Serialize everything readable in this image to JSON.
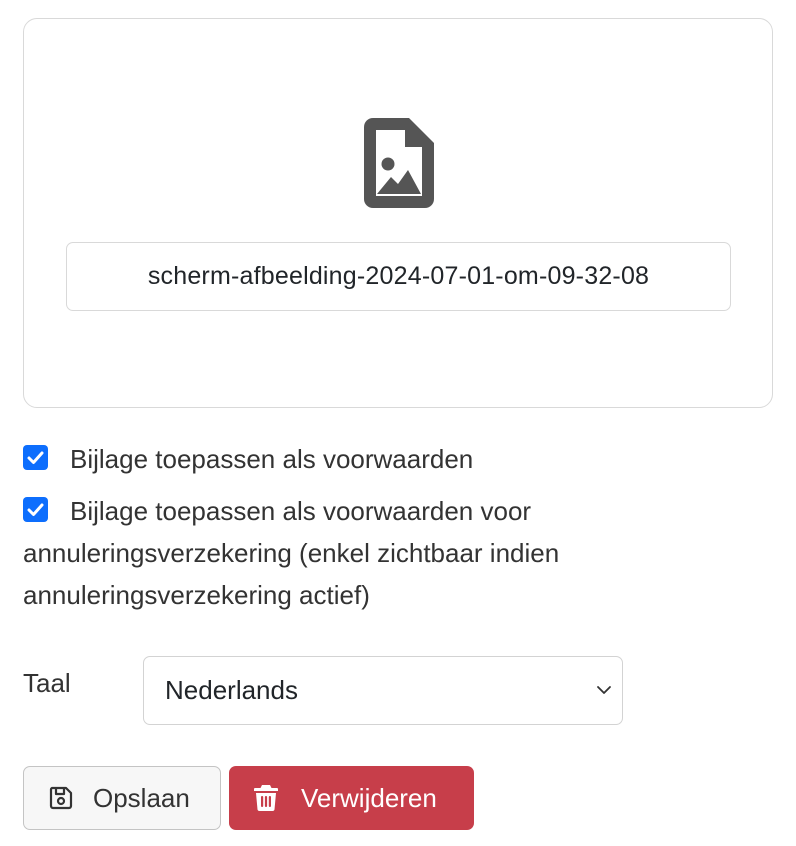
{
  "attachment": {
    "icon": "file-image-icon",
    "filename": "scherm-afbeelding-2024-07-01-om-09-32-08"
  },
  "options": [
    {
      "label": "Bijlage toepassen als voorwaarden",
      "checked": true
    },
    {
      "label": "Bijlage toepassen als voorwaarden voor annuleringsverzekering (enkel zichtbaar indien annuleringsverzekering actief)",
      "checked": true
    }
  ],
  "language": {
    "label": "Taal",
    "selected": "Nederlands"
  },
  "actions": {
    "save_label": "Opslaan",
    "save_icon": "floppy-disk-icon",
    "delete_label": "Verwijderen",
    "delete_icon": "trash-icon"
  },
  "colors": {
    "checkbox": "#0d6efd",
    "delete_button": "#c73e4a",
    "icon": "#555555"
  }
}
